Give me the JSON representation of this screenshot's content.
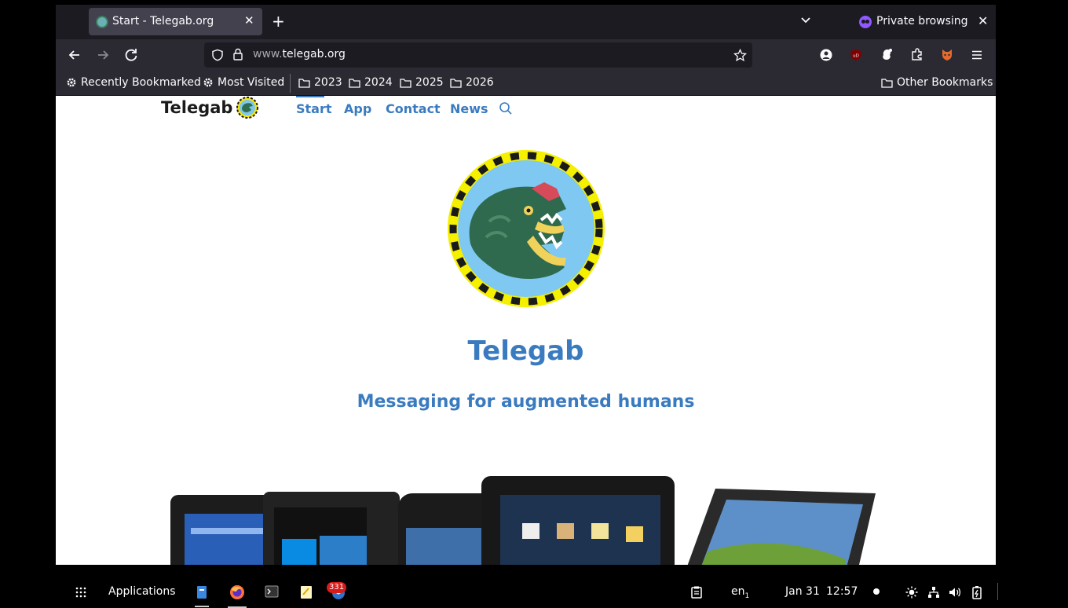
{
  "browser": {
    "tab_title": "Start - Telegab.org",
    "private_label": "Private browsing",
    "url_prefix": "www.",
    "url_domain": "telegab.org"
  },
  "bookmarks": {
    "recently": "Recently Bookmarked",
    "most_visited": "Most Visited",
    "folders": [
      "2023",
      "2024",
      "2025",
      "2026"
    ],
    "other": "Other Bookmarks"
  },
  "site": {
    "logo_text": "Telegab",
    "nav": [
      "Start",
      "App",
      "Contact",
      "News"
    ],
    "title": "Telegab",
    "subtitle": "Messaging for augmented humans"
  },
  "taskbar": {
    "apps_label": "Applications",
    "badge_count": "331",
    "keyboard": "en",
    "keyboard_sub": "1",
    "date": "Jan 31",
    "time": "12:57"
  },
  "colors": {
    "accent": "#3a7bc0",
    "tab_bg": "#42414d",
    "toolbar_bg": "#2b2a33"
  }
}
